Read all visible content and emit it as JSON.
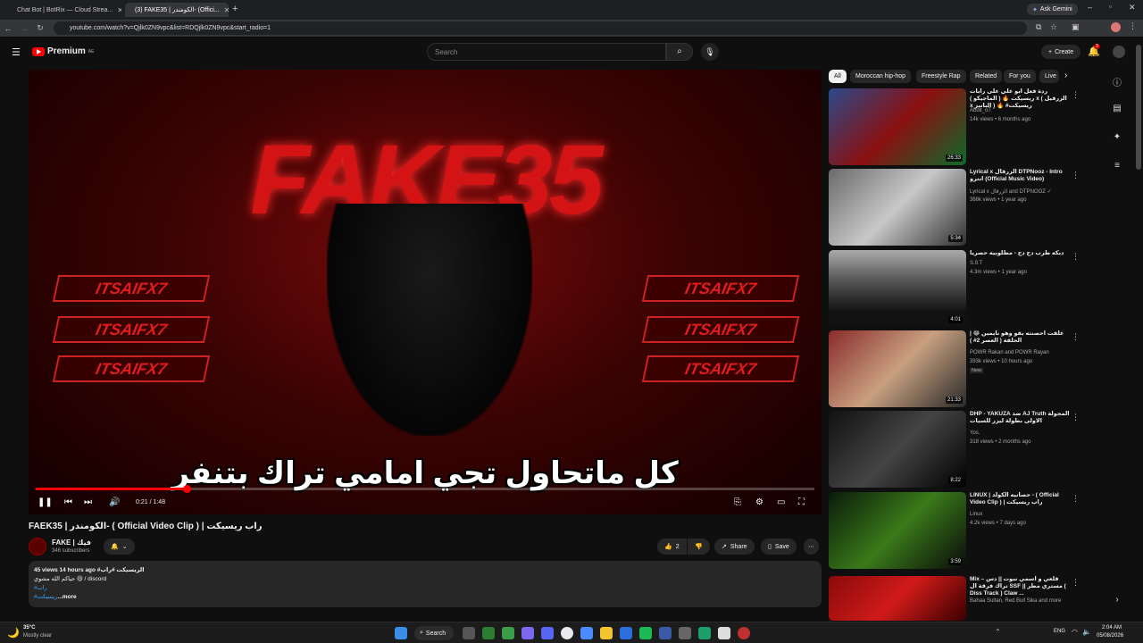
{
  "browser": {
    "tabs": [
      {
        "title": "Chat Bot | BotRix — Cloud Strea..."
      },
      {
        "title": "(3) FAKE35 | الكومندر- (Offici..."
      }
    ],
    "ask_gemini": "Ask Gemini",
    "url": "youtube.com/watch?v=Qjlk0ZN9vpc&list=RDQjlk0ZN9vpc&start_radio=1"
  },
  "youtube": {
    "logo_text": "Premium",
    "logo_region": "AE",
    "search_placeholder": "Search",
    "create_label": "Create",
    "notif_count": "3"
  },
  "player": {
    "art_title": "FAKE35",
    "plate_text": "ITSAIFX7",
    "caption": "كل ماتحاول تجي امامي تراك بتنفر",
    "time": "0:21 / 1:48",
    "progress": 0.194
  },
  "video": {
    "title": "FAEK35 | الكومندر- ( Official Video Clip ) | راب ريسيكت",
    "channel": "FAKE | فيك",
    "subscribers": "346 subscribers",
    "likes": "2",
    "share": "Share",
    "save": "Save",
    "desc_stats": "45 views  14 hours ago  #الريسيكت #راب",
    "desc_line1": "حياكم الله مشوي 😃 / discord",
    "desc_line2": "#راب",
    "desc_line3": "#ريسيكت",
    "desc_more": "...more"
  },
  "chips": [
    "All",
    "Moroccan hip-hop",
    "Freestyle Rap",
    "Related",
    "For you",
    "Live"
  ],
  "recommendations": [
    {
      "title": "ردة فعل ابو علي على رابات ريسيكت 🔥 ( الماجيكو ) x ( الزرفيل x البانيز ) 🔥 #ريسيكت",
      "channel": "Abdit_o7",
      "meta": "14k views • 6 months ago",
      "duration": "26:33",
      "badge": ""
    },
    {
      "title": "Lyrical x الزرقال DTPNooz - Intro انترو (Official Music Video)",
      "channel": "Lyrical x الزرقال and DTPNOOZ ✓",
      "meta": "368k views • 1 year ago",
      "duration": "5:34",
      "badge": ""
    },
    {
      "title": "دبكه طرب دح دح - مطلوبيه حصرياً",
      "channel": "S.9.T",
      "meta": "4.3m views • 1 year ago",
      "duration": "4:01",
      "badge": ""
    },
    {
      "title": "علقت احصنته بقو وهو نايمين 😂 | الحلقة ( العصر 2# )",
      "channel": "POWR Rakan and POWR Rayan",
      "meta": "393k views • 10 hours ago",
      "duration": "21:33",
      "badge": "New"
    },
    {
      "title": "DHP - YAKUZA ضد AJ Truth المجولة الاولى بطولة ليزر للسيات",
      "channel": "Yos.",
      "meta": "318 views • 2 months ago",
      "duration": "8:22",
      "badge": ""
    },
    {
      "title": "LINUX | حصانيه الكولد - ( Official Video Clip ) | راب ريسيكت",
      "channel": "Linux",
      "meta": "4.2k views • 7 days ago",
      "duration": "3:59",
      "badge": ""
    },
    {
      "title": "Mix – قلعي و اسمي نبوت || دس تراك فرقة ال SSF || مستري مطر ( Diss Track ) Claw ...",
      "channel": "Bahaa Sultan, Red Bull Sika and more",
      "meta": "",
      "duration": "",
      "badge": ""
    }
  ],
  "taskbar": {
    "weather_temp": "35°C",
    "weather_desc": "Mostly clear",
    "search_label": "Search",
    "lang": "ENG",
    "time": "2:04 AM",
    "date": "05/08/2026"
  },
  "colors": {
    "accent": "#ff0000",
    "bg": "#0f0f0f",
    "chip": "#272727"
  }
}
